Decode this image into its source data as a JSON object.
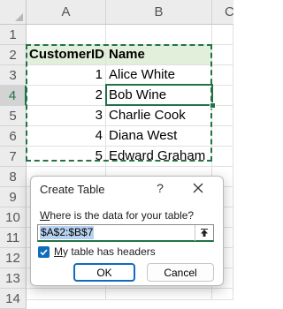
{
  "sheet": {
    "columns": [
      {
        "label": "A",
        "selected": false
      },
      {
        "label": "B",
        "selected": false
      },
      {
        "label": "C",
        "selected": false
      }
    ],
    "rows": [
      "1",
      "2",
      "3",
      "4",
      "5",
      "6",
      "7",
      "8",
      "9",
      "10",
      "11",
      "12",
      "13",
      "14"
    ],
    "selected_row": "4",
    "header": {
      "a": "CustomerID",
      "b": "Name"
    },
    "data": [
      {
        "id": "1",
        "name": "Alice White"
      },
      {
        "id": "2",
        "name": "Bob Wine"
      },
      {
        "id": "3",
        "name": "Charlie Cook"
      },
      {
        "id": "4",
        "name": "Diana West"
      },
      {
        "id": "5",
        "name": "Edward Graham"
      }
    ]
  },
  "dialog": {
    "title": "Create Table",
    "help": "?",
    "prompt": "Where is the data for your table?",
    "range_value": "$A$2:$B$7",
    "headers_label": "My table has headers",
    "headers_checked": true,
    "ok_label": "OK",
    "cancel_label": "Cancel"
  },
  "icons": {
    "close": "close-icon",
    "collapse": "collapse-range-icon",
    "check": "checkmark-icon"
  },
  "colors": {
    "excel_green": "#217346",
    "header_fill": "#e2efda",
    "accent_blue": "#0f6cbd"
  }
}
